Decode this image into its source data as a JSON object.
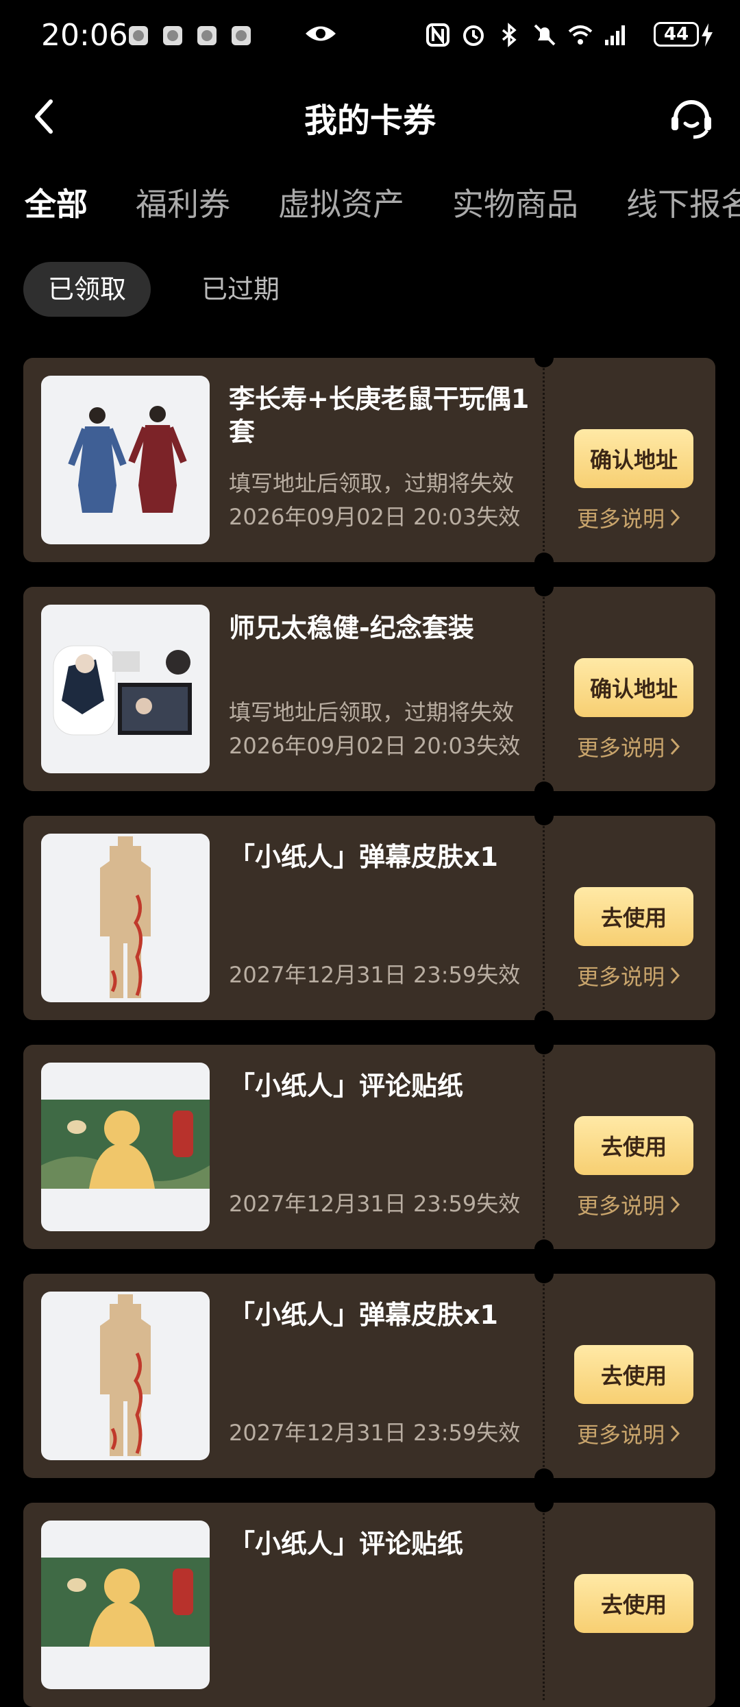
{
  "status_bar": {
    "time": "20:06",
    "battery": "44"
  },
  "header": {
    "title": "我的卡券"
  },
  "tabs": [
    {
      "label": "全部",
      "active": true
    },
    {
      "label": "福利券",
      "active": false
    },
    {
      "label": "虚拟资产",
      "active": false
    },
    {
      "label": "实物商品",
      "active": false
    },
    {
      "label": "线下报名",
      "active": false
    }
  ],
  "filters": [
    {
      "label": "已领取",
      "active": true
    },
    {
      "label": "已过期",
      "active": false
    }
  ],
  "cards": [
    {
      "title": "李长寿+长庚老鼠干玩偶1套",
      "desc": "填写地址后领取，过期将失效",
      "expire": "2026年09月02日 20:03失效",
      "action": "确认地址",
      "more": "更多说明"
    },
    {
      "title": "师兄太稳健-纪念套装",
      "desc": "填写地址后领取，过期将失效",
      "expire": "2026年09月02日 20:03失效",
      "action": "确认地址",
      "more": "更多说明"
    },
    {
      "title": "「小纸人」弹幕皮肤x1",
      "desc": "",
      "expire": "2027年12月31日 23:59失效",
      "action": "去使用",
      "more": "更多说明"
    },
    {
      "title": "「小纸人」评论贴纸",
      "desc": "",
      "expire": "2027年12月31日 23:59失效",
      "action": "去使用",
      "more": "更多说明"
    },
    {
      "title": "「小纸人」弹幕皮肤x1",
      "desc": "",
      "expire": "2027年12月31日 23:59失效",
      "action": "去使用",
      "more": "更多说明"
    },
    {
      "title": "「小纸人」评论贴纸",
      "desc": "",
      "expire": "",
      "action": "去使用",
      "more": ""
    }
  ],
  "colors": {
    "card_bg": "#3a2f26",
    "button_gold": "#f7cf72",
    "more_text": "#c9a56c"
  }
}
